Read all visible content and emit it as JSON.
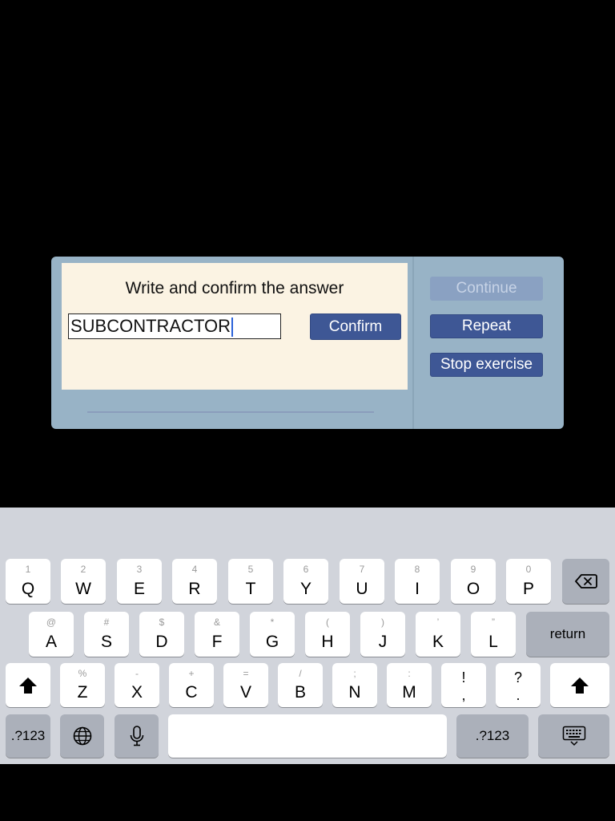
{
  "dialog": {
    "instruction": "Write and confirm the answer",
    "answer_value": "SUBCONTRACTOR",
    "confirm_label": "Confirm",
    "continue_label": "Continue",
    "repeat_label": "Repeat",
    "stop_label": "Stop exercise"
  },
  "keyboard": {
    "row1": [
      {
        "hint": "1",
        "key": "Q"
      },
      {
        "hint": "2",
        "key": "W"
      },
      {
        "hint": "3",
        "key": "E"
      },
      {
        "hint": "4",
        "key": "R"
      },
      {
        "hint": "5",
        "key": "T"
      },
      {
        "hint": "6",
        "key": "Y"
      },
      {
        "hint": "7",
        "key": "U"
      },
      {
        "hint": "8",
        "key": "I"
      },
      {
        "hint": "9",
        "key": "O"
      },
      {
        "hint": "0",
        "key": "P"
      }
    ],
    "row2": [
      {
        "hint": "@",
        "key": "A"
      },
      {
        "hint": "#",
        "key": "S"
      },
      {
        "hint": "$",
        "key": "D"
      },
      {
        "hint": "&",
        "key": "F"
      },
      {
        "hint": "*",
        "key": "G"
      },
      {
        "hint": "(",
        "key": "H"
      },
      {
        "hint": ")",
        "key": "J"
      },
      {
        "hint": "’",
        "key": "K"
      },
      {
        "hint": "”",
        "key": "L"
      }
    ],
    "row3": [
      {
        "hint": "%",
        "key": "Z"
      },
      {
        "hint": "-",
        "key": "X"
      },
      {
        "hint": "+",
        "key": "C"
      },
      {
        "hint": "=",
        "key": "V"
      },
      {
        "hint": "/",
        "key": "B"
      },
      {
        "hint": ";",
        "key": "N"
      },
      {
        "hint": ":",
        "key": "M"
      }
    ],
    "bang_top": "!",
    "bang_bottom": ",",
    "question_top": "?",
    "question_bottom": ".",
    "return_label": "return",
    "numbers_label": ".?123",
    "icons": {
      "delete": "backspace-icon",
      "shift": "shift-icon",
      "globe": "globe-icon",
      "mic": "microphone-icon",
      "dismiss": "keyboard-dismiss-icon"
    }
  }
}
